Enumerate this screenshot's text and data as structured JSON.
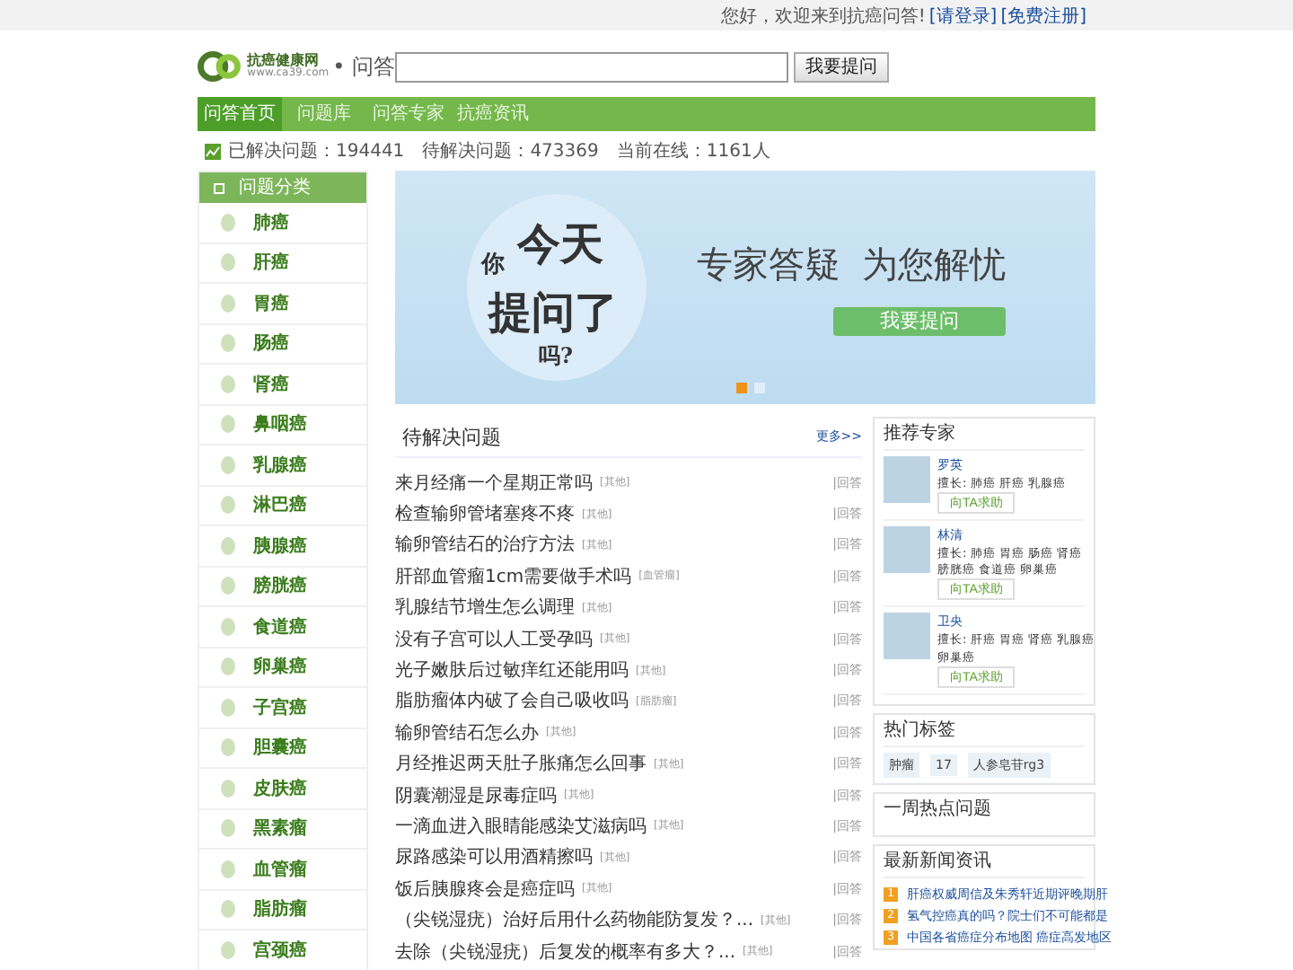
{
  "top_bar": {
    "greeting": "您好，欢迎来到抗癌问答!",
    "login": "[请登录]",
    "register": "[免费注册]"
  },
  "logo": {
    "name": "抗癌健康网",
    "url": "www.ca39.com",
    "suffix": "• 问答"
  },
  "search": {
    "button": "我要提问"
  },
  "nav": [
    {
      "label": "问答首页",
      "selected": true
    },
    {
      "label": "问题库",
      "selected": false
    },
    {
      "label": "问答专家",
      "selected": false
    },
    {
      "label": "抗癌资讯",
      "selected": false
    }
  ],
  "stats": [
    {
      "label": "已解决问题：",
      "value": "194441"
    },
    {
      "label": "待解决问题：",
      "value": "473369"
    },
    {
      "label": "当前在线：",
      "value": "1161人"
    }
  ],
  "sidebar": {
    "title": "问题分类",
    "items": [
      "肺癌",
      "肝癌",
      "胃癌",
      "肠癌",
      "肾癌",
      "鼻咽癌",
      "乳腺癌",
      "淋巴癌",
      "胰腺癌",
      "膀胱癌",
      "食道癌",
      "卵巢癌",
      "子宫癌",
      "胆囊癌",
      "皮肤癌",
      "黑素瘤",
      "血管瘤",
      "脂肪瘤",
      "宫颈癌"
    ]
  },
  "banner": {
    "bubble": [
      "你",
      "今天",
      "提问了",
      "吗?"
    ],
    "headline": "专家答疑",
    "subline": "为您解忧",
    "button": "我要提问",
    "slides": [
      {
        "selected": true
      },
      {
        "selected": false
      }
    ]
  },
  "questions": {
    "title": "待解决问题",
    "more": "更多>>",
    "rows": [
      {
        "text": "来月经痛一个星期正常吗",
        "tag": "[其他]",
        "action": "|回答"
      },
      {
        "text": "检查输卵管堵塞疼不疼",
        "tag": "[其他]",
        "action": "|回答"
      },
      {
        "text": "输卵管结石的治疗方法",
        "tag": "[其他]",
        "action": "|回答"
      },
      {
        "text": "肝部血管瘤1cm需要做手术吗",
        "tag": "[血管瘤]",
        "action": "|回答"
      },
      {
        "text": "乳腺结节增生怎么调理",
        "tag": "[其他]",
        "action": "|回答"
      },
      {
        "text": "没有子宫可以人工受孕吗",
        "tag": "[其他]",
        "action": "|回答"
      },
      {
        "text": "光子嫩肤后过敏痒红还能用吗",
        "tag": "[其他]",
        "action": "|回答"
      },
      {
        "text": "脂肪瘤体内破了会自己吸收吗",
        "tag": "[脂肪瘤]",
        "action": "|回答"
      },
      {
        "text": "输卵管结石怎么办",
        "tag": "[其他]",
        "action": "|回答"
      },
      {
        "text": "月经推迟两天肚子胀痛怎么回事",
        "tag": "[其他]",
        "action": "|回答"
      },
      {
        "text": "阴囊潮湿是尿毒症吗",
        "tag": "[其他]",
        "action": "|回答"
      },
      {
        "text": "一滴血进入眼睛能感染艾滋病吗",
        "tag": "[其他]",
        "action": "|回答"
      },
      {
        "text": "尿路感染可以用酒精擦吗",
        "tag": "[其他]",
        "action": "|回答"
      },
      {
        "text": "饭后胰腺疼会是癌症吗",
        "tag": "[其他]",
        "action": "|回答"
      },
      {
        "text": "（尖锐湿疣）治好后用什么药物能防复发？...",
        "tag": "[其他]",
        "action": "|回答"
      },
      {
        "text": "去除（尖锐湿疣）后复发的概率有多大？...",
        "tag": "[其他]",
        "action": "|回答"
      }
    ]
  },
  "experts": {
    "title": "推荐专家",
    "items": [
      {
        "name": "罗英",
        "specialty": [
          "擅长: 肺癌 肝癌 乳腺癌"
        ],
        "button": "向TA求助"
      },
      {
        "name": "林清",
        "specialty": [
          "擅长: 肺癌 胃癌 肠癌 肾癌",
          "膀胱癌 食道癌 卵巢癌"
        ],
        "button": "向TA求助"
      },
      {
        "name": "卫央",
        "specialty": [
          "擅长: 肝癌 胃癌 肾癌 乳腺癌",
          "卵巢癌"
        ],
        "button": "向TA求助"
      }
    ]
  },
  "hot_tags": {
    "title": "热门标签",
    "tags": [
      "肿瘤",
      "17",
      "人参皂苷rg3"
    ]
  },
  "weekly": {
    "title": "一周热点问题"
  },
  "news": {
    "title": "最新新闻资讯",
    "items": [
      {
        "rank": "1",
        "text": "肝癌权威周信及朱秀轩近期评晚期肝"
      },
      {
        "rank": "2",
        "text": "氢气控癌真的吗？院士们不可能都是"
      },
      {
        "rank": "3",
        "text": "中国各省癌症分布地图 癌症高发地区"
      }
    ]
  }
}
